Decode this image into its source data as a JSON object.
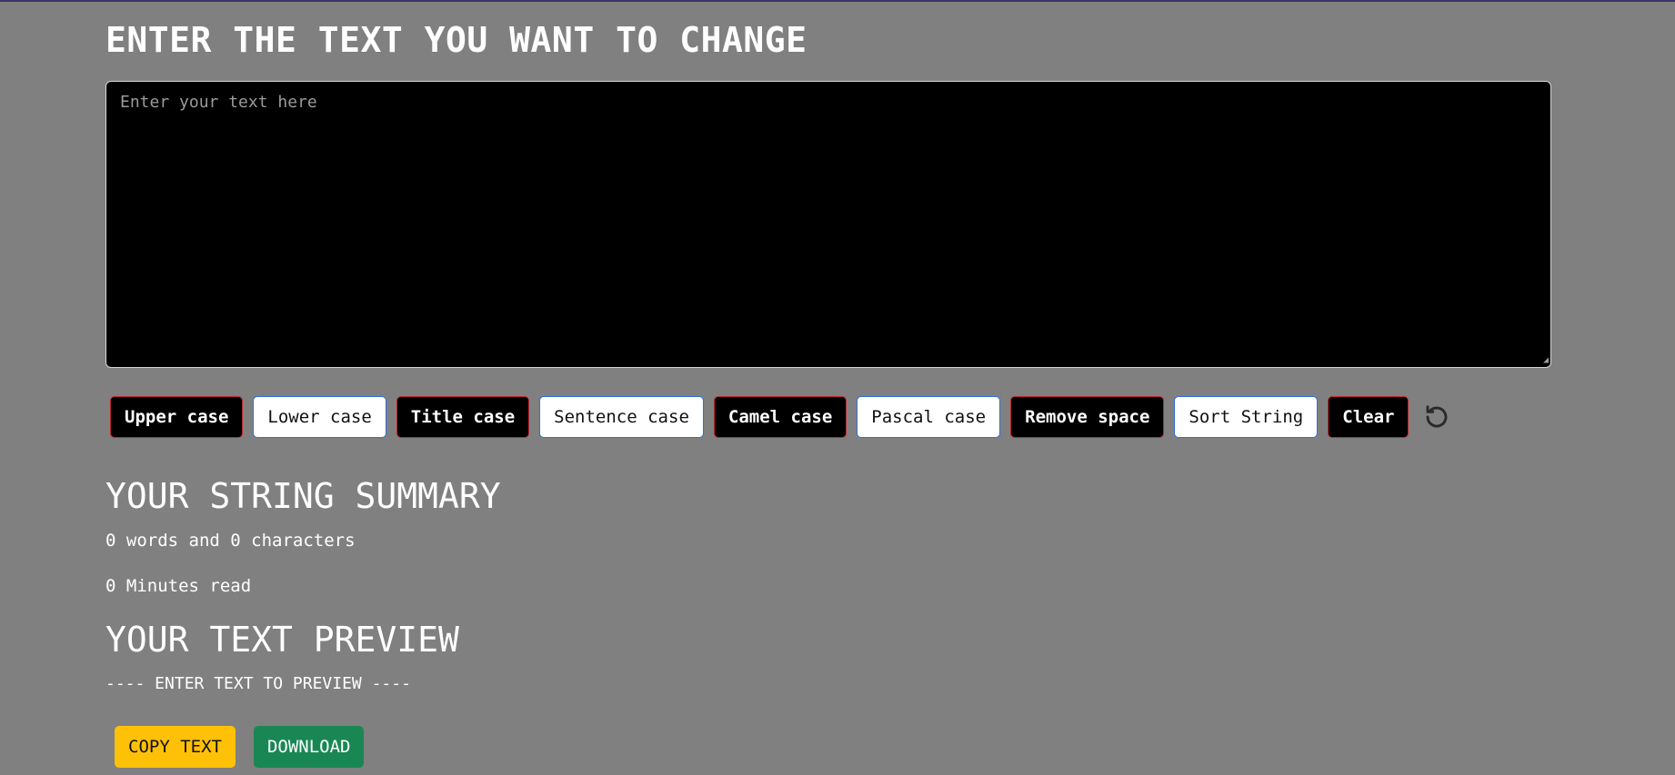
{
  "header": {
    "title": "ENTER THE TEXT YOU WANT TO CHANGE"
  },
  "editor": {
    "value": "",
    "placeholder": "Enter your text here"
  },
  "toolbar": {
    "buttons": [
      {
        "label": "Upper case",
        "style": "dark"
      },
      {
        "label": "Lower case",
        "style": "light"
      },
      {
        "label": "Title case",
        "style": "dark"
      },
      {
        "label": "Sentence case",
        "style": "light"
      },
      {
        "label": "Camel case",
        "style": "dark"
      },
      {
        "label": "Pascal case",
        "style": "light"
      },
      {
        "label": "Remove space",
        "style": "dark"
      },
      {
        "label": "Sort String",
        "style": "light"
      },
      {
        "label": "Clear",
        "style": "dark"
      }
    ],
    "undo_icon": "undo-icon"
  },
  "summary": {
    "title": "YOUR STRING SUMMARY",
    "words_text": "0 words and 0 characters",
    "minutes_text": "0 Minutes read"
  },
  "preview": {
    "title": "YOUR TEXT PREVIEW",
    "placeholder_text": "---- ENTER TEXT TO PREVIEW ----"
  },
  "actions": {
    "copy_label": "COPY TEXT",
    "download_label": "DOWNLOAD"
  },
  "colors": {
    "page_background": "#808080",
    "editor_background": "#000000",
    "dark_button_border": "#c0262f",
    "light_button_border": "#2f6fe0",
    "copy_button": "#ffc107",
    "download_button": "#198754"
  }
}
